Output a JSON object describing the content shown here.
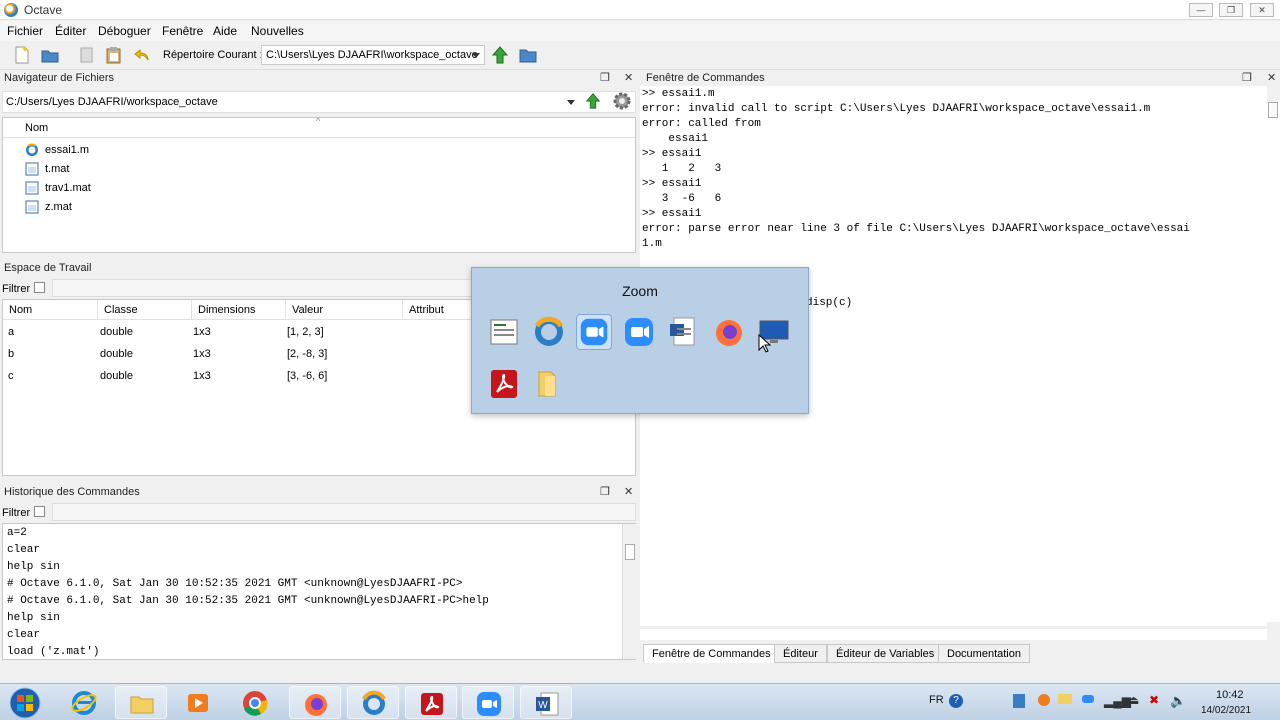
{
  "window": {
    "title": "Octave",
    "min_label": "—",
    "max_label": "❐",
    "close_label": "✕"
  },
  "menu": [
    "Fichier",
    "Éditer",
    "Déboguer",
    "Fenêtre",
    "Aide",
    "Nouvelles"
  ],
  "toolbar": {
    "current_dir_label": "Répertoire Courant :",
    "current_dir_value": "C:\\Users\\Lyes DJAAFRI\\workspace_octave"
  },
  "file_browser": {
    "title": "Navigateur de Fichiers",
    "path": "C:/Users/Lyes DJAAFRI/workspace_octave",
    "column": "Nom",
    "files": [
      {
        "name": "essai1.m",
        "icon": "octave-script-icon"
      },
      {
        "name": "t.mat",
        "icon": "mat-file-icon"
      },
      {
        "name": "trav1.mat",
        "icon": "mat-file-icon"
      },
      {
        "name": "z.mat",
        "icon": "mat-file-icon"
      }
    ]
  },
  "workspace": {
    "title": "Espace de Travail",
    "filter_label": "Filtrer",
    "columns": [
      "Nom",
      "Classe",
      "Dimensions",
      "Valeur",
      "Attribut"
    ],
    "rows": [
      [
        "a",
        "double",
        "1x3",
        "[1, 2, 3]",
        ""
      ],
      [
        "b",
        "double",
        "1x3",
        "[2, -8, 3]",
        ""
      ],
      [
        "c",
        "double",
        "1x3",
        "[3, -6, 6]",
        ""
      ]
    ]
  },
  "history": {
    "title": "Historique des Commandes",
    "filter_label": "Filtrer",
    "lines": [
      "a=2",
      "clear",
      "help sin",
      "# Octave 6.1.0, Sat Jan 30 10:52:35 2021 GMT <unknown@LyesDJAAFRI-PC>",
      "# Octave 6.1.0, Sat Jan 30 10:52:35 2021 GMT <unknown@LyesDJAAFRI-PC>help",
      "help sin",
      "clear",
      "load ('z.mat')"
    ]
  },
  "command_window": {
    "title": "Fenêtre de Commandes",
    "lines": [
      ">> essai1.m",
      "error: invalid call to script C:\\Users\\Lyes DJAAFRI\\workspace_octave\\essai1.m",
      "error: called from",
      "    essai1",
      ">> essai1",
      "   1   2   3",
      ">> essai1",
      "   3  -6   6",
      ">> essai1",
      "error: parse error near line 3 of file C:\\Users\\Lyes DJAAFRI\\workspace_octave\\essai",
      "1.m"
    ],
    "partial_line": "disp(c)"
  },
  "tabs": [
    "Fenêtre de Commandes",
    "Éditeur",
    "Éditeur de Variables",
    "Documentation"
  ],
  "zoom_popup": {
    "title": "Zoom",
    "apps": [
      "spreadsheet-icon",
      "octave-icon",
      "zoom-icon",
      "zoom-icon",
      "word-doc-icon",
      "firefox-icon",
      "monitor-icon",
      "pdf-icon",
      "folder-icon"
    ]
  },
  "taskbar": {
    "apps": [
      "start-orb",
      "internet-explorer-icon",
      "explorer-icon",
      "media-player-icon",
      "chrome-icon",
      "firefox-icon",
      "octave-icon",
      "acrobat-icon",
      "zoom-icon",
      "word-icon"
    ],
    "lang": "FR",
    "time": "10:42",
    "date": "14/02/2021"
  },
  "colors": {
    "accent": "#2d8cff",
    "popup_bg": "#b9cfe6",
    "taskbar": "#c9d9ea"
  }
}
